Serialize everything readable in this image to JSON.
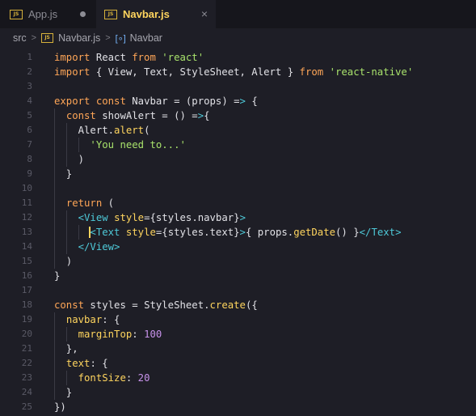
{
  "tabs": [
    {
      "label": "App.js",
      "badge": "JS",
      "modified": true,
      "active": false
    },
    {
      "label": "Navbar.js",
      "badge": "JS",
      "modified": false,
      "active": true
    }
  ],
  "breadcrumb": {
    "folder": "src",
    "file": "Navbar.js",
    "file_badge": "JS",
    "symbol_icon": "[∘]",
    "symbol": "Navbar"
  },
  "editor": {
    "line_numbers": [
      "1",
      "2",
      "3",
      "4",
      "5",
      "6",
      "7",
      "8",
      "9",
      "10",
      "11",
      "12",
      "13",
      "14",
      "15",
      "16",
      "17",
      "18",
      "19",
      "20",
      "21",
      "22",
      "23",
      "24",
      "25"
    ],
    "lines": [
      "import React from 'react'",
      "import { View, Text, StyleSheet, Alert } from 'react-native'",
      "",
      "export const Navbar = (props) => {",
      "  const showAlert = () =>{",
      "    Alert.alert(",
      "      'You need to...'",
      "    )",
      "  }",
      "",
      "  return (",
      "    <View style={styles.navbar}>",
      "      <Text style={styles.text}>{ props.getDate() }</Text>",
      "    </View>",
      "  )",
      "}",
      "",
      "const styles = StyleSheet.create({",
      "  navbar: {",
      "    marginTop: 100",
      "  },",
      "  text: {",
      "    fontSize: 20",
      "  }",
      "})"
    ]
  },
  "colors": {
    "background": "#1e1e26",
    "keyword": "#ffa657",
    "string": "#a8e26b",
    "function": "#ffd55e",
    "tag": "#4ec9d8",
    "number": "#c792ea"
  }
}
